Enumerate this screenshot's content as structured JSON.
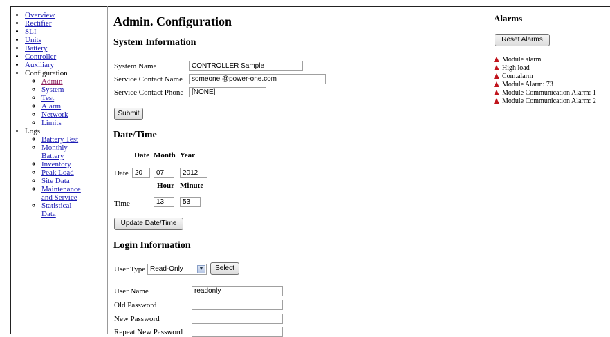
{
  "nav": {
    "items": [
      {
        "label": "Overview"
      },
      {
        "label": "Rectifier"
      },
      {
        "label": "SLI"
      },
      {
        "label": "Units"
      },
      {
        "label": "Battery"
      },
      {
        "label": "Controller"
      },
      {
        "label": "Auxiliary"
      }
    ],
    "configuration": {
      "label": "Configuration",
      "children": [
        "Admin",
        "System",
        "Test",
        "Alarm",
        "Network",
        "Limits"
      ]
    },
    "logs": {
      "label": "Logs",
      "children": [
        "Battery Test",
        "Monthly Battery",
        "Inventory",
        "Peak Load",
        "Site Data",
        "Maintenance and Service",
        "Statistical Data"
      ]
    }
  },
  "main": {
    "title": "Admin. Configuration",
    "system_info": {
      "heading": "System Information",
      "system_name_label": "System Name",
      "system_name_value": "CONTROLLER Sample",
      "contact_name_label": "Service Contact Name",
      "contact_name_value": "someone @power-one.com",
      "contact_phone_label": "Service Contact Phone",
      "contact_phone_value": "[NONE]",
      "submit_label": "Submit"
    },
    "datetime": {
      "heading": "Date/Time",
      "date_header": "Date",
      "month_header": "Month",
      "year_header": "Year",
      "date_row_label": "Date",
      "date_value": "20",
      "month_value": "07",
      "year_value": "2012",
      "hour_header": "Hour",
      "minute_header": "Minute",
      "time_row_label": "Time",
      "hour_value": "13",
      "minute_value": "53",
      "update_label": "Update Date/Time"
    },
    "login": {
      "heading": "Login Information",
      "user_type_label": "User Type",
      "user_type_value": "Read-Only",
      "select_label": "Select",
      "user_name_label": "User Name",
      "user_name_value": "readonly",
      "old_password_label": "Old Password",
      "new_password_label": "New Password",
      "repeat_password_label": "Repeat New Password"
    }
  },
  "alarms": {
    "heading": "Alarms",
    "reset_label": "Reset Alarms",
    "alarm_color": "#c0141c",
    "items": [
      "Module alarm",
      "High load",
      "Com.alarm",
      "Module Alarm: 73",
      "Module Communication Alarm: 1",
      "Module Communication Alarm: 2"
    ]
  }
}
